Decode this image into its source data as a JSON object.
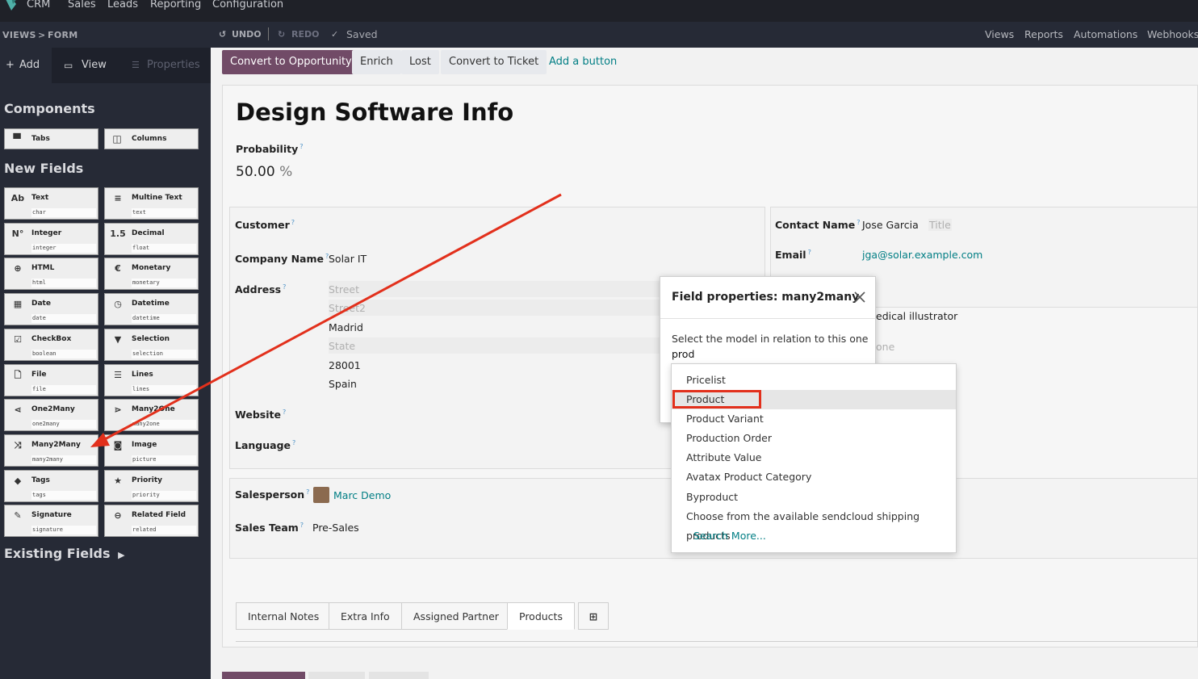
{
  "topnav": {
    "app": "CRM",
    "items": [
      "Sales",
      "Leads",
      "Reporting",
      "Configuration"
    ]
  },
  "studiobar": {
    "crumb_views": "VIEWS",
    "crumb_sep": ">",
    "crumb_form": "FORM",
    "undo": "UNDO",
    "redo": "REDO",
    "saved": "Saved",
    "right_links": [
      "Views",
      "Reports",
      "Automations",
      "Webhooks"
    ]
  },
  "sidebar": {
    "tabs": {
      "add": "Add",
      "view": "View",
      "properties": "Properties"
    },
    "components_heading": "Components",
    "components": [
      {
        "label": "Tabs",
        "icon": "tabs-icon"
      },
      {
        "label": "Columns",
        "icon": "columns-icon"
      }
    ],
    "new_fields_heading": "New Fields",
    "fields": [
      {
        "label": "Text",
        "tech": "char",
        "glyph": "Ab"
      },
      {
        "label": "Multine Text",
        "tech": "text",
        "glyph": "≡"
      },
      {
        "label": "Integer",
        "tech": "integer",
        "glyph": "N°"
      },
      {
        "label": "Decimal",
        "tech": "float",
        "glyph": "1.5"
      },
      {
        "label": "HTML",
        "tech": "html",
        "glyph": "⊕"
      },
      {
        "label": "Monetary",
        "tech": "monetary",
        "glyph": "€"
      },
      {
        "label": "Date",
        "tech": "date",
        "glyph": "▦"
      },
      {
        "label": "Datetime",
        "tech": "datetime",
        "glyph": "◷"
      },
      {
        "label": "CheckBox",
        "tech": "boolean",
        "glyph": "☑"
      },
      {
        "label": "Selection",
        "tech": "selection",
        "glyph": "▼"
      },
      {
        "label": "File",
        "tech": "file",
        "glyph": "🗋"
      },
      {
        "label": "Lines",
        "tech": "lines",
        "glyph": "☰"
      },
      {
        "label": "One2Many",
        "tech": "one2many",
        "glyph": "⋖"
      },
      {
        "label": "Many2One",
        "tech": "many2one",
        "glyph": "⋗"
      },
      {
        "label": "Many2Many",
        "tech": "many2many",
        "glyph": "⤨"
      },
      {
        "label": "Image",
        "tech": "picture",
        "glyph": "◙"
      },
      {
        "label": "Tags",
        "tech": "tags",
        "glyph": "◆"
      },
      {
        "label": "Priority",
        "tech": "priority",
        "glyph": "★"
      },
      {
        "label": "Signature",
        "tech": "signature",
        "glyph": "✎"
      },
      {
        "label": "Related Field",
        "tech": "related",
        "glyph": "⊖"
      }
    ],
    "existing_fields": "Existing Fields"
  },
  "actions": {
    "convert_opportunity": "Convert to Opportunity",
    "enrich": "Enrich",
    "lost": "Lost",
    "convert_ticket": "Convert to Ticket",
    "add_button": "Add a button"
  },
  "form": {
    "title": "Design Software Info",
    "probability_label": "Probability",
    "probability_value": "50.00",
    "probability_unit": "%",
    "customer_label": "Customer",
    "company_label": "Company Name",
    "company_value": "Solar IT",
    "address_label": "Address",
    "street_ph": "Street",
    "street2_ph": "Street2",
    "city": "Madrid",
    "state_ph": "State",
    "zip": "28001",
    "country": "Spain",
    "website_label": "Website",
    "language_label": "Language",
    "contact_label": "Contact Name",
    "contact_value": "Jose Garcia",
    "title_ph": "Title",
    "email_label": "Email",
    "email_value": "jga@solar.example.com",
    "job_partial": "edical illustrator",
    "phone_partial": "one",
    "salesperson_label": "Salesperson",
    "salesperson_value": "Marc Demo",
    "salesteam_label": "Sales Team",
    "salesteam_value": "Pre-Sales",
    "tooltip_mark": "?"
  },
  "tabs": [
    "Internal Notes",
    "Extra Info",
    "Assigned Partner",
    "Products"
  ],
  "modal": {
    "title": "Field properties: many2many",
    "model_label": "Select the model in relation to this one",
    "model_input": "prod"
  },
  "dropdown": {
    "items": [
      "Pricelist",
      "Product",
      "Product Variant",
      "Production Order",
      "Attribute Value",
      "Avatax Product Category",
      "Byproduct",
      "Choose from the available sendcloud shipping products"
    ],
    "highlighted_index": 1,
    "search_more": "Search More..."
  },
  "colors": {
    "brand": "#714b67",
    "link": "#017e84",
    "annotation": "#e2301c",
    "sidebar_bg": "#262a36"
  }
}
